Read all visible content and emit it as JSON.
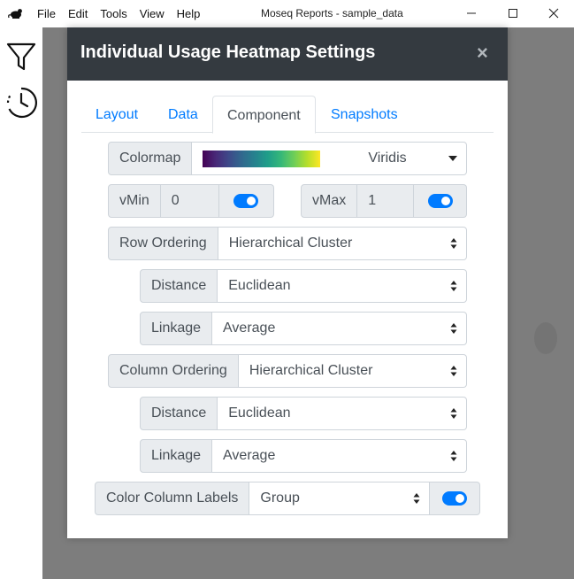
{
  "window": {
    "title": "Moseq Reports - sample_data",
    "menu": [
      "File",
      "Edit",
      "Tools",
      "View",
      "Help"
    ]
  },
  "sidebar": {
    "icons": [
      "filter-icon",
      "history-clock-icon"
    ]
  },
  "modal": {
    "title": "Individual Usage Heatmap Settings",
    "close_label": "×",
    "tabs": [
      "Layout",
      "Data",
      "Component",
      "Snapshots"
    ],
    "active_tab": "Component",
    "colormap": {
      "label": "Colormap",
      "value": "Viridis",
      "gradient": [
        "#440154",
        "#3e4989",
        "#26828e",
        "#35b779",
        "#fde725"
      ]
    },
    "vmin": {
      "label": "vMin",
      "value": "0",
      "enabled": true
    },
    "vmax": {
      "label": "vMax",
      "value": "1",
      "enabled": true
    },
    "row_ordering": {
      "label": "Row Ordering",
      "value": "Hierarchical Cluster",
      "distance": {
        "label": "Distance",
        "value": "Euclidean"
      },
      "linkage": {
        "label": "Linkage",
        "value": "Average"
      }
    },
    "column_ordering": {
      "label": "Column Ordering",
      "value": "Hierarchical Cluster",
      "distance": {
        "label": "Distance",
        "value": "Euclidean"
      },
      "linkage": {
        "label": "Linkage",
        "value": "Average"
      }
    },
    "color_column_labels": {
      "label": "Color Column Labels",
      "value": "Group",
      "enabled": true
    }
  },
  "colors": {
    "accent": "#007bff",
    "header_bg": "#343a40",
    "addon_bg": "#e9ecef",
    "border": "#ced4da",
    "backdrop": "#7d7d7d"
  }
}
